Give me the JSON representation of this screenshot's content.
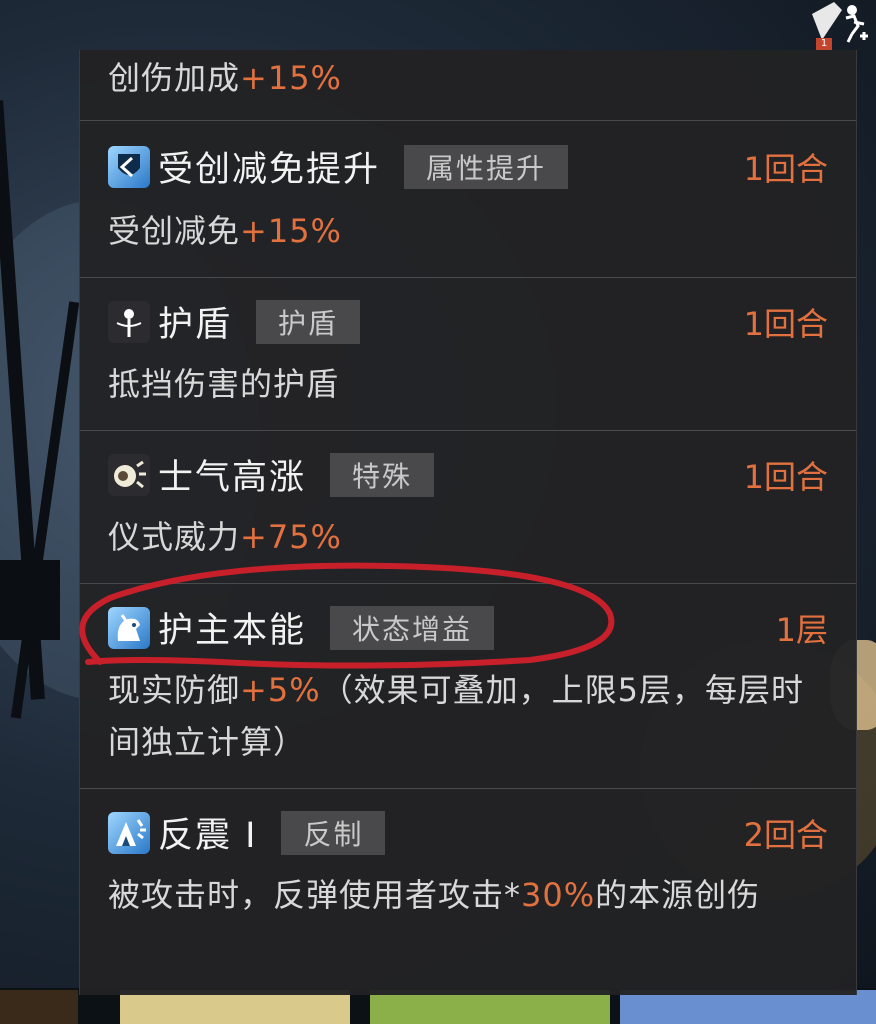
{
  "corner": {
    "badge": "1"
  },
  "effects": [
    {
      "name": "",
      "tag": "",
      "duration": "",
      "desc_pre": "创伤加成",
      "desc_value": "+15%",
      "desc_post": "",
      "icon": "damage-boost-icon"
    },
    {
      "name": "受创减免提升",
      "tag": "属性提升",
      "duration": "1回合",
      "desc_pre": "受创减免",
      "desc_value": "+15%",
      "desc_post": "",
      "icon": "shield-reduction-icon"
    },
    {
      "name": "护盾",
      "tag": "护盾",
      "duration": "1回合",
      "desc_pre": "抵挡伤害的护盾",
      "desc_value": "",
      "desc_post": "",
      "icon": "shield-pin-icon"
    },
    {
      "name": "士气高涨",
      "tag": "特殊",
      "duration": "1回合",
      "desc_pre": "仪式威力",
      "desc_value": "+75%",
      "desc_post": "",
      "icon": "morale-icon"
    },
    {
      "name": "护主本能",
      "tag": "状态增益",
      "duration": "1层",
      "desc_pre": "现实防御",
      "desc_value": "+5%",
      "desc_post": "（效果可叠加，上限5层，每层时间独立计算）",
      "icon": "guardian-beast-icon"
    },
    {
      "name": "反震 I",
      "tag": "反制",
      "duration": "2回合",
      "desc_pre": "被攻击时，反弹使用者攻击*",
      "desc_value": "30%",
      "desc_post": "的本源创伤",
      "icon": "counter-shock-icon"
    }
  ],
  "colors": {
    "panel": "#222224",
    "highlight": "#e2713f",
    "tag_bg": "#49494c",
    "annotation": "#c8202a"
  }
}
